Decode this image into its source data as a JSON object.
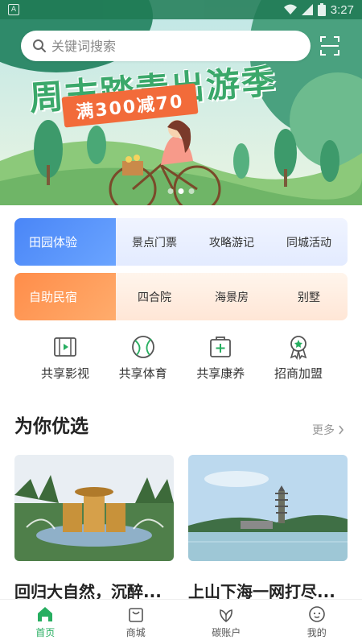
{
  "status_bar": {
    "time": "3:27"
  },
  "search": {
    "placeholder": "关键词搜索"
  },
  "banner": {
    "title": "周末踏青出游季",
    "promo": "满300减70",
    "slides": 3,
    "active_slide": 1
  },
  "categories": [
    {
      "main": "田园体验",
      "items": [
        "景点门票",
        "攻略游记",
        "同城活动"
      ]
    },
    {
      "main": "自助民宿",
      "items": [
        "四合院",
        "海景房",
        "别墅"
      ]
    }
  ],
  "services": [
    {
      "label": "共享影视",
      "icon": "film-icon"
    },
    {
      "label": "共享体育",
      "icon": "ball-icon"
    },
    {
      "label": "共享康养",
      "icon": "medical-kit-icon"
    },
    {
      "label": "招商加盟",
      "icon": "award-ribbon-icon"
    }
  ],
  "recommend": {
    "title": "为你优选",
    "more": "更多",
    "cards": [
      {
        "title": "回归大自然，沉醉..."
      },
      {
        "title": "上山下海一网打尽..."
      }
    ]
  },
  "bottom_nav": [
    {
      "label": "首页",
      "icon": "home-icon",
      "active": true
    },
    {
      "label": "商城",
      "icon": "shopping-bag-icon",
      "active": false
    },
    {
      "label": "碳账户",
      "icon": "leaf-icon",
      "active": false
    },
    {
      "label": "我的",
      "icon": "profile-face-icon",
      "active": false
    }
  ],
  "colors": {
    "accent_green": "#27ae60",
    "blue_tag": "#4a86f7",
    "orange_tag": "#ff8d4a",
    "promo_red": "#f26b3a"
  }
}
